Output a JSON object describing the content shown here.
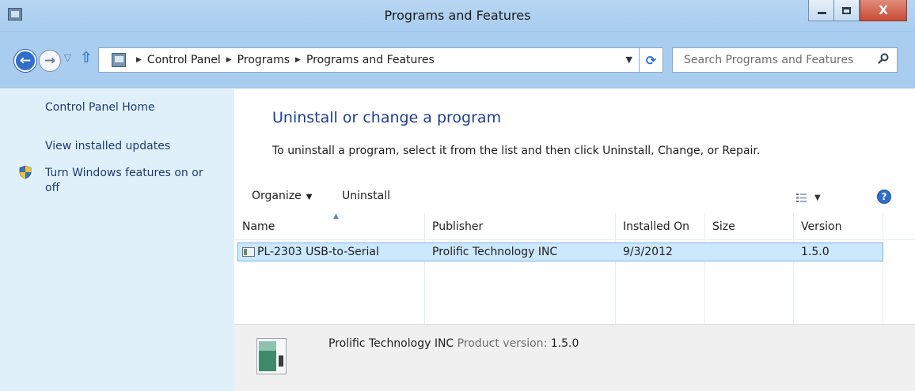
{
  "window": {
    "title": "Programs and Features",
    "close_label": "X"
  },
  "nav": {
    "back_glyph": "←",
    "forward_glyph": "→",
    "up_glyph": "⇧",
    "refresh_glyph": "⟳"
  },
  "address": {
    "crumbs": [
      "Control Panel",
      "Programs",
      "Programs and Features"
    ]
  },
  "search": {
    "placeholder": "Search Programs and Features"
  },
  "sidebar": {
    "home": "Control Panel Home",
    "updates": "View installed updates",
    "features_line1": "Turn Windows features on or",
    "features_line2": "off"
  },
  "main": {
    "heading": "Uninstall or change a program",
    "instructions": "To uninstall a program, select it from the list and then click Uninstall, Change, or Repair."
  },
  "toolbar": {
    "organize": "Organize",
    "uninstall": "Uninstall",
    "help": "?"
  },
  "table": {
    "columns": [
      "Name",
      "Publisher",
      "Installed On",
      "Size",
      "Version"
    ],
    "rows": [
      {
        "name": "PL-2303 USB-to-Serial",
        "publisher": "Prolific Technology INC",
        "installed_on": "9/3/2012",
        "size": "",
        "version": "1.5.0"
      }
    ]
  },
  "details": {
    "publisher": "Prolific Technology INC",
    "version_label": "Product version:",
    "version": "1.5.0"
  },
  "colors": {
    "accent": "#2f6fca",
    "heading": "#1e3f91",
    "selection": "#cce8ff",
    "sidebar_bg": "#dff0fb"
  },
  "icons": [
    "control-panel-icon",
    "back-arrow-icon",
    "forward-arrow-icon",
    "up-arrow-icon",
    "refresh-icon",
    "search-icon",
    "shield-icon",
    "program-icon",
    "views-icon",
    "help-icon"
  ]
}
